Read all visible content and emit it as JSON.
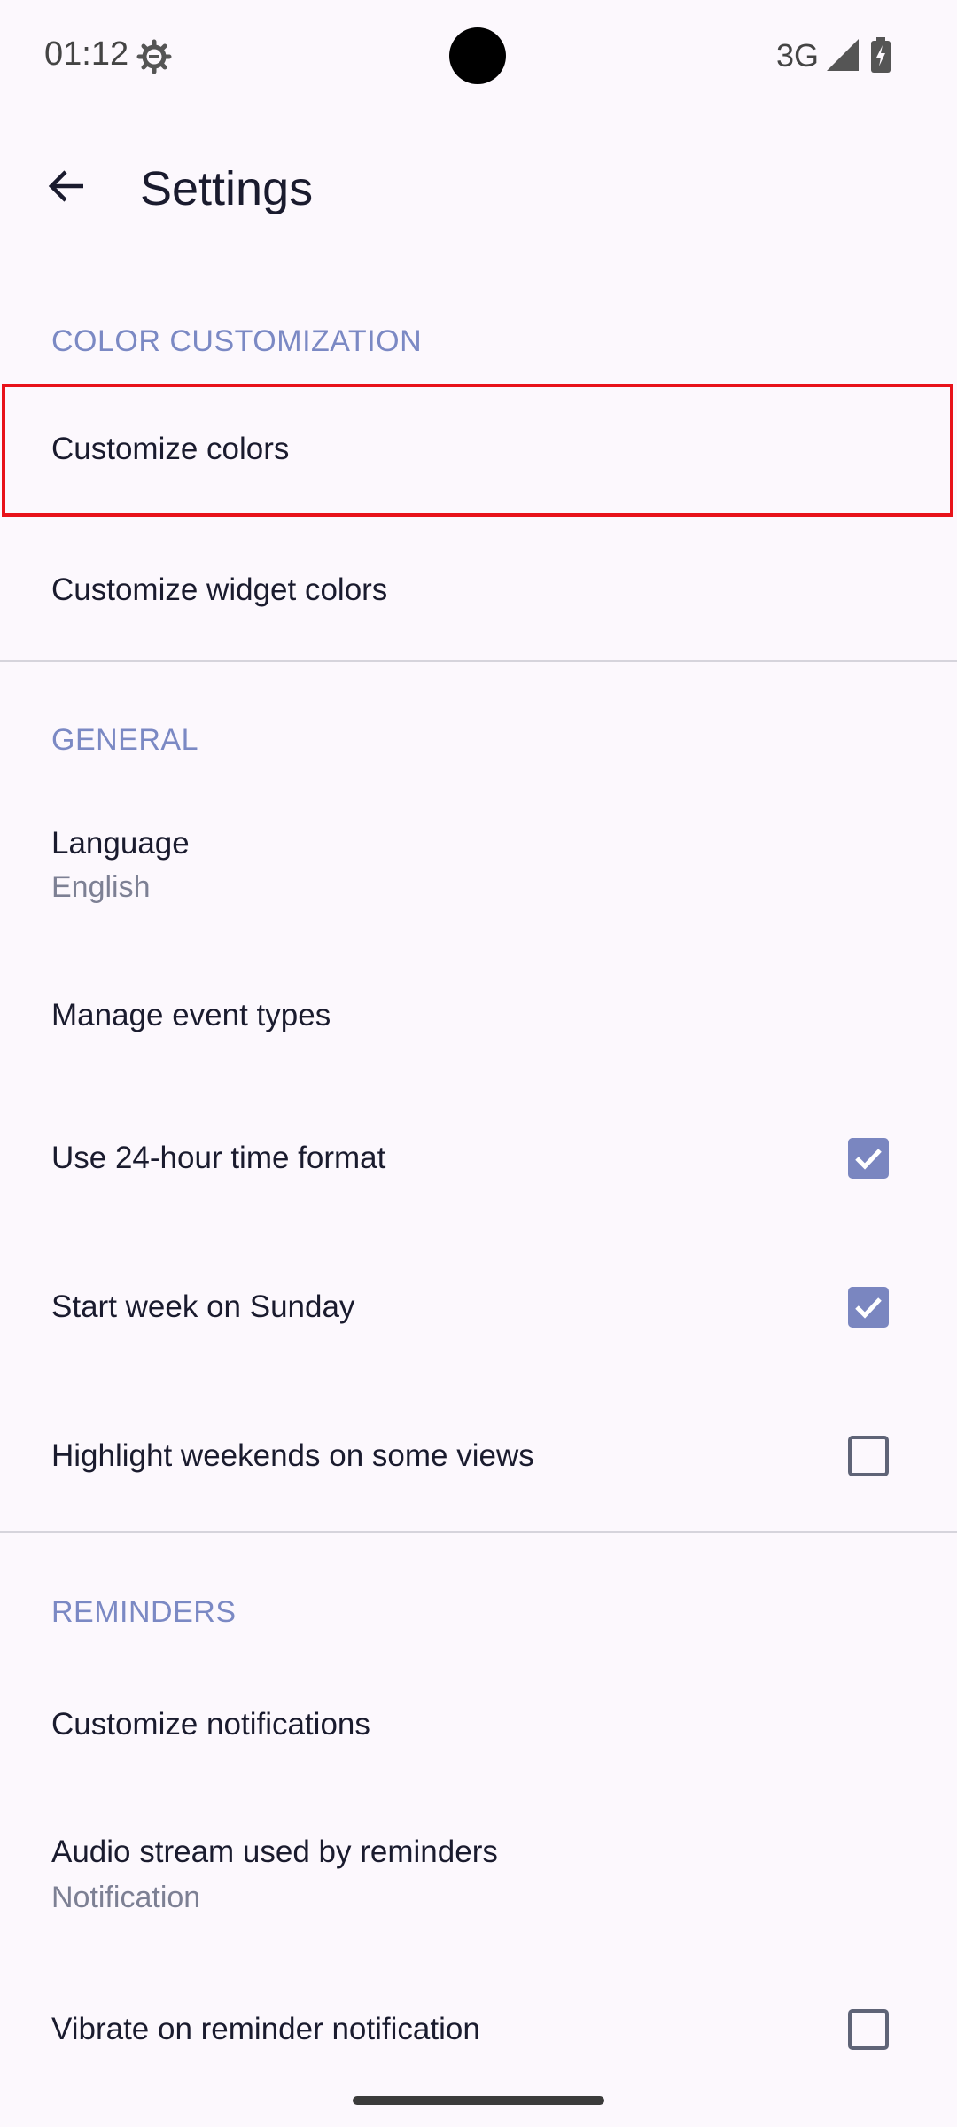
{
  "status_bar": {
    "time": "01:12",
    "network": "3G",
    "icons": [
      "gear-icon",
      "signal-icon",
      "battery-charging-icon"
    ]
  },
  "app_bar": {
    "title": "Settings",
    "back_icon": "arrow-back-icon"
  },
  "sections": {
    "color": {
      "header": "COLOR CUSTOMIZATION",
      "items": [
        {
          "title": "Customize colors",
          "highlighted": true
        },
        {
          "title": "Customize widget colors"
        }
      ]
    },
    "general": {
      "header": "GENERAL",
      "items": [
        {
          "title": "Language",
          "subtitle": "English"
        },
        {
          "title": "Manage event types"
        },
        {
          "title": "Use 24-hour time format",
          "checked": true
        },
        {
          "title": "Start week on Sunday",
          "checked": true
        },
        {
          "title": "Highlight weekends on some views",
          "checked": false
        }
      ]
    },
    "reminders": {
      "header": "REMINDERS",
      "items": [
        {
          "title": "Customize notifications"
        },
        {
          "title": "Audio stream used by reminders",
          "subtitle": "Notification"
        },
        {
          "title": "Vibrate on reminder notification",
          "checked": false
        }
      ]
    }
  },
  "colors": {
    "accent": "#7a86c0",
    "section_header": "#7b89c4",
    "highlight_border": "#e8121a",
    "background": "#fcf8fd"
  }
}
